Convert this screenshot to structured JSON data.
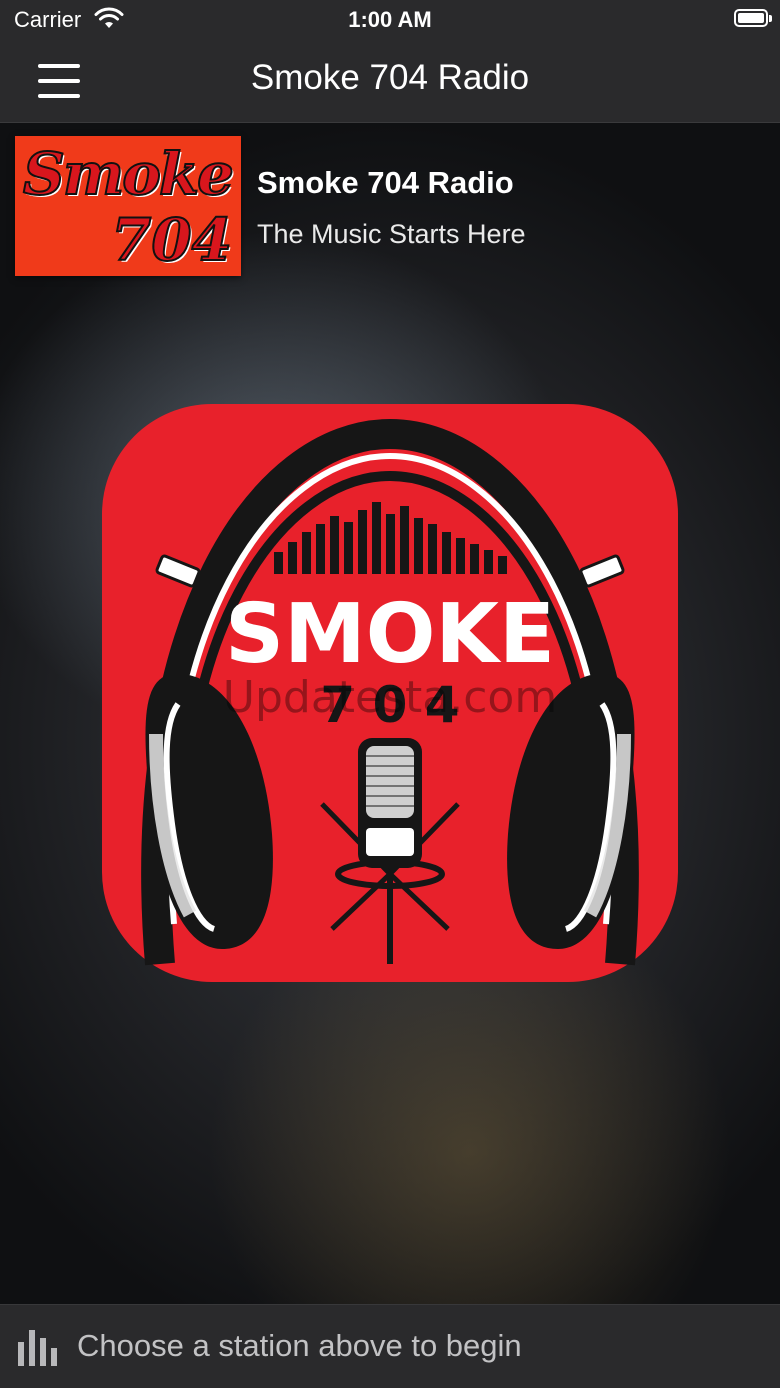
{
  "status_bar": {
    "carrier": "Carrier",
    "time": "1:00 AM",
    "icons": [
      "wifi-icon",
      "battery-icon"
    ]
  },
  "nav": {
    "title": "Smoke 704 Radio",
    "menu_icon": "hamburger-menu-icon"
  },
  "station": {
    "logo_text_line1": "Smoke",
    "logo_text_line2": "704",
    "name": "Smoke 704 Radio",
    "tagline": "The Music Starts Here"
  },
  "artwork": {
    "title_text": "SMOKE",
    "number_text": "7 0 4",
    "watermark": "Updatesta.com",
    "background_color": "#e8212b"
  },
  "player": {
    "status_text": "Choose a station above to begin",
    "icon": "equalizer-icon"
  },
  "colors": {
    "bar_background": "#2a2a2c",
    "logo_red": "#f03a1a",
    "artwork_red": "#e8212b"
  }
}
